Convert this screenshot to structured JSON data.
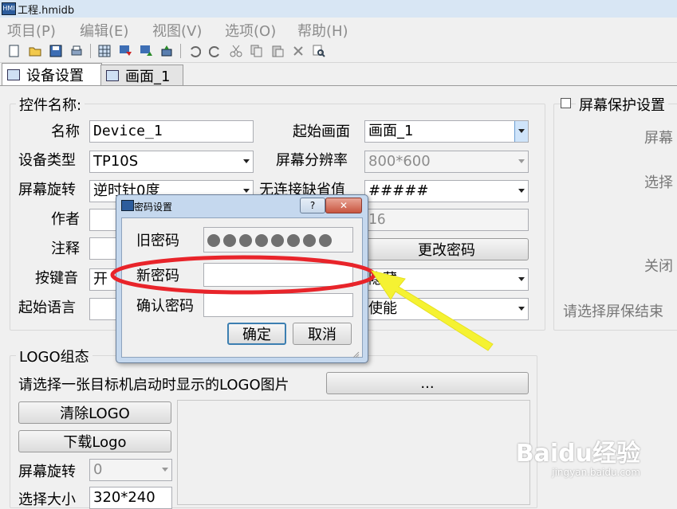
{
  "window": {
    "title": "工程.hmidb",
    "app_icon": "hmi-app-icon"
  },
  "menu": [
    {
      "label": "项目(P)"
    },
    {
      "label": "编辑(E)"
    },
    {
      "label": "视图(V)"
    },
    {
      "label": "选项(O)"
    },
    {
      "label": "帮助(H)"
    }
  ],
  "toolbar": [
    "new-file-icon",
    "open-folder-icon",
    "save-icon",
    "print-icon",
    "grid-icon",
    "download-icon",
    "upload-icon",
    "compile-icon",
    "undo-icon",
    "redo-icon",
    "cut-icon",
    "copy-icon",
    "paste-icon",
    "delete-icon",
    "search-icon"
  ],
  "tabs": [
    {
      "label": "设备设置",
      "active": true
    },
    {
      "label": "画面_1",
      "active": false
    }
  ],
  "control_group": {
    "title": "控件名称:",
    "name_label": "名称",
    "name_value": "Device_1",
    "device_type_label": "设备类型",
    "device_type_value": "TP10S",
    "rotation_label": "屏幕旋转",
    "rotation_value": "逆时针0度",
    "author_label": "作者",
    "note_label": "注释",
    "beep_label": "按键音",
    "beep_value": "开",
    "lang_label": "起始语言",
    "start_screen_label": "起始画面",
    "start_screen_value": "画面_1",
    "resolution_label": "屏幕分辨率",
    "resolution_value": "800*600",
    "default_label": "无连接缺省值",
    "default_value": "#####",
    "field_value_16": "16",
    "change_password_button": "更改密码",
    "hide_value": "隐藏",
    "enable_value": "使能"
  },
  "screensaver": {
    "checkbox_label": "屏幕保护设置",
    "label_screen": "屏幕",
    "label_select": "选择",
    "label_close": "关闭",
    "label_end": "请选择屏保结束"
  },
  "logo_group": {
    "title": "LOGO组态",
    "prompt": "请选择一张目标机启动时显示的LOGO图片",
    "browse_button": "...",
    "clear_button": "清除LOGO",
    "download_button": "下载Logo",
    "rotation_label": "屏幕旋转",
    "rotation_value": "0",
    "size_label": "选择大小",
    "size_value": "320*240"
  },
  "password_dialog": {
    "title": "密码设置",
    "help_button": "?",
    "old_label": "旧密码",
    "old_value_dots": 8,
    "new_label": "新密码",
    "new_value": "",
    "confirm_label": "确认密码",
    "confirm_value": "",
    "ok_button": "确定",
    "cancel_button": "取消"
  },
  "watermark": {
    "brand": "Baidu经验",
    "url": "jingyan.baidu.com"
  },
  "colors": {
    "highlight_ellipse": "#e8242a",
    "arrow": "#f5f232",
    "dialog_frame": "#c5d8ee"
  }
}
